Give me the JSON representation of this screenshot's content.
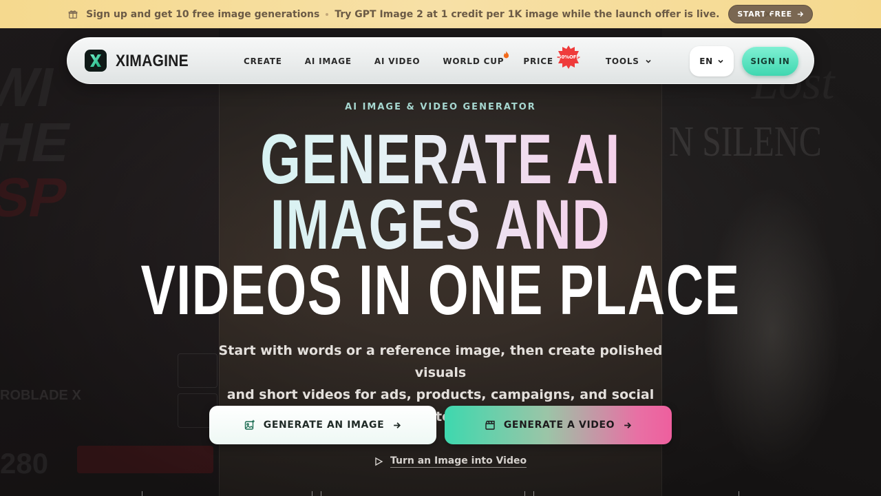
{
  "announcement": {
    "part1": "Sign up and get 10 free image generations",
    "part2": "Try GPT Image 2 at 1 credit per 1K image while the launch offer is live.",
    "cta": "START FREE",
    "icons": {
      "gift": "gift-icon",
      "close": "close-icon",
      "arrow": "arrow-right-icon"
    }
  },
  "nav": {
    "brand": "XIMAGINE",
    "items": [
      {
        "label": "CREATE"
      },
      {
        "label": "AI IMAGE"
      },
      {
        "label": "AI VIDEO"
      },
      {
        "label": "WORLD CUP"
      },
      {
        "label": "PRICE",
        "badge": "50%OFF"
      },
      {
        "label": "TOOLS"
      }
    ],
    "language": "EN",
    "signin": "SIGN IN"
  },
  "hero": {
    "eyebrow": "AI IMAGE & VIDEO GENERATOR",
    "headline_line1": "GENERATE AI",
    "headline_line2": "IMAGES AND",
    "headline_line3": "VIDEOS IN ONE PLACE",
    "subtitle_line1": "Start with words or a reference image, then create polished visuals",
    "subtitle_line2": "and short videos for ads, products, campaigns, and social content.",
    "btn_image": "GENERATE AN IMAGE",
    "btn_video": "GENERATE A VIDEO",
    "link_video": "Turn an Image into Video"
  },
  "colors": {
    "announce_bg": "#f5d98e",
    "accent_green": "#3fd7b0",
    "accent_pink": "#ee5f9e",
    "badge_red": "#ef3b3b"
  }
}
